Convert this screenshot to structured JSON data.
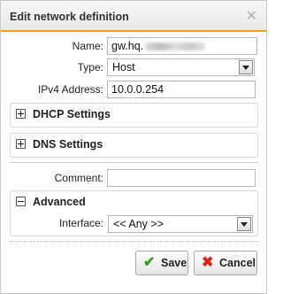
{
  "dialog": {
    "title": "Edit network definition",
    "close_glyph": "✕"
  },
  "form": {
    "name_label": "Name:",
    "name_value": "gw.hq.",
    "type_label": "Type:",
    "type_value": "Host",
    "ipv4_label": "IPv4 Address:",
    "ipv4_value": "10.0.0.254",
    "comment_label": "Comment:",
    "comment_value": ""
  },
  "sections": {
    "dhcp": "DHCP Settings",
    "dns": "DNS Settings",
    "advanced": "Advanced"
  },
  "advanced": {
    "interface_label": "Interface:",
    "interface_value": "<< Any >>"
  },
  "buttons": {
    "save": "Save",
    "cancel": "Cancel",
    "save_icon": "✔",
    "cancel_icon": "✖"
  },
  "colors": {
    "accent": "#f39a1e",
    "save_green": "#3a9a27",
    "cancel_red": "#d3261d"
  },
  "icons": [
    "close-icon",
    "dropdown-arrow-icon",
    "expand-icon",
    "collapse-icon",
    "checkmark-icon",
    "x-icon"
  ]
}
